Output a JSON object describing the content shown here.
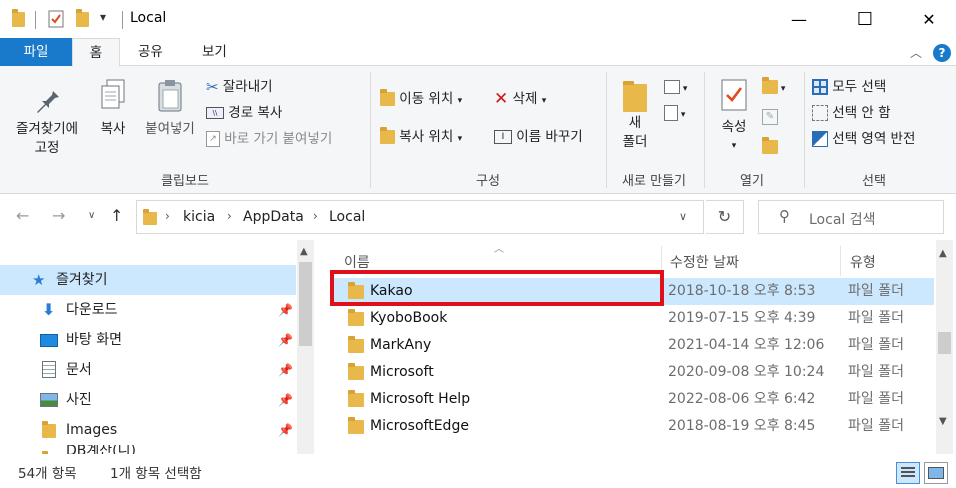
{
  "window": {
    "title": "Local",
    "minimize": "—",
    "maximize": "☐",
    "close": "✕"
  },
  "quick_access": {
    "dropdown": "▾"
  },
  "menu": {
    "tabs": [
      "파일",
      "홈",
      "공유",
      "보기"
    ],
    "help": "?"
  },
  "ribbon": {
    "clipboard": {
      "pin_label_1": "즐겨찾기에",
      "pin_label_2": "고정",
      "copy": "복사",
      "paste": "붙여넣기",
      "cut": "잘라내기",
      "copy_path": "경로 복사",
      "paste_shortcut": "바로 가기 붙여넣기",
      "group": "클립보드"
    },
    "organize": {
      "move_to": "이동 위치",
      "copy_to": "복사 위치",
      "delete": "삭제",
      "rename": "이름 바꾸기",
      "group": "구성"
    },
    "new": {
      "new_folder_1": "새",
      "new_folder_2": "폴더",
      "group": "새로 만들기"
    },
    "open": {
      "properties": "속성",
      "group": "열기"
    },
    "select": {
      "select_all": "모두 선택",
      "select_none": "선택 안 함",
      "invert": "선택 영역 반전",
      "group": "선택"
    }
  },
  "address": {
    "segments": [
      "kicia",
      "AppData",
      "Local"
    ],
    "search_placeholder": "Local 검색"
  },
  "nav_pane": {
    "items": [
      {
        "label": "즐겨찾기",
        "selected": true
      },
      {
        "label": "다운로드"
      },
      {
        "label": "바탕 화면"
      },
      {
        "label": "문서"
      },
      {
        "label": "사진"
      },
      {
        "label": "Images"
      },
      {
        "label": "DB계산(니)"
      }
    ]
  },
  "file_list": {
    "columns": {
      "name": "이름",
      "date": "수정한 날짜",
      "type": "유형"
    },
    "rows": [
      {
        "name": "Kakao",
        "date": "2018-10-18 오후 8:53",
        "type": "파일 폴더",
        "selected": true
      },
      {
        "name": "KyoboBook",
        "date": "2019-07-15 오후 4:39",
        "type": "파일 폴더"
      },
      {
        "name": "MarkAny",
        "date": "2021-04-14 오후 12:06",
        "type": "파일 폴더"
      },
      {
        "name": "Microsoft",
        "date": "2020-09-08 오후 10:24",
        "type": "파일 폴더"
      },
      {
        "name": "Microsoft Help",
        "date": "2022-08-06 오후 6:42",
        "type": "파일 폴더"
      },
      {
        "name": "MicrosoftEdge",
        "date": "2018-08-19 오후 8:45",
        "type": "파일 폴더"
      }
    ]
  },
  "status": {
    "count": "54개 항목",
    "selected": "1개 항목 선택함"
  },
  "colors": {
    "accent": "#1979ca",
    "selection": "#cce8ff",
    "highlight_box": "#e0101a",
    "folder": "#e8b84a"
  }
}
